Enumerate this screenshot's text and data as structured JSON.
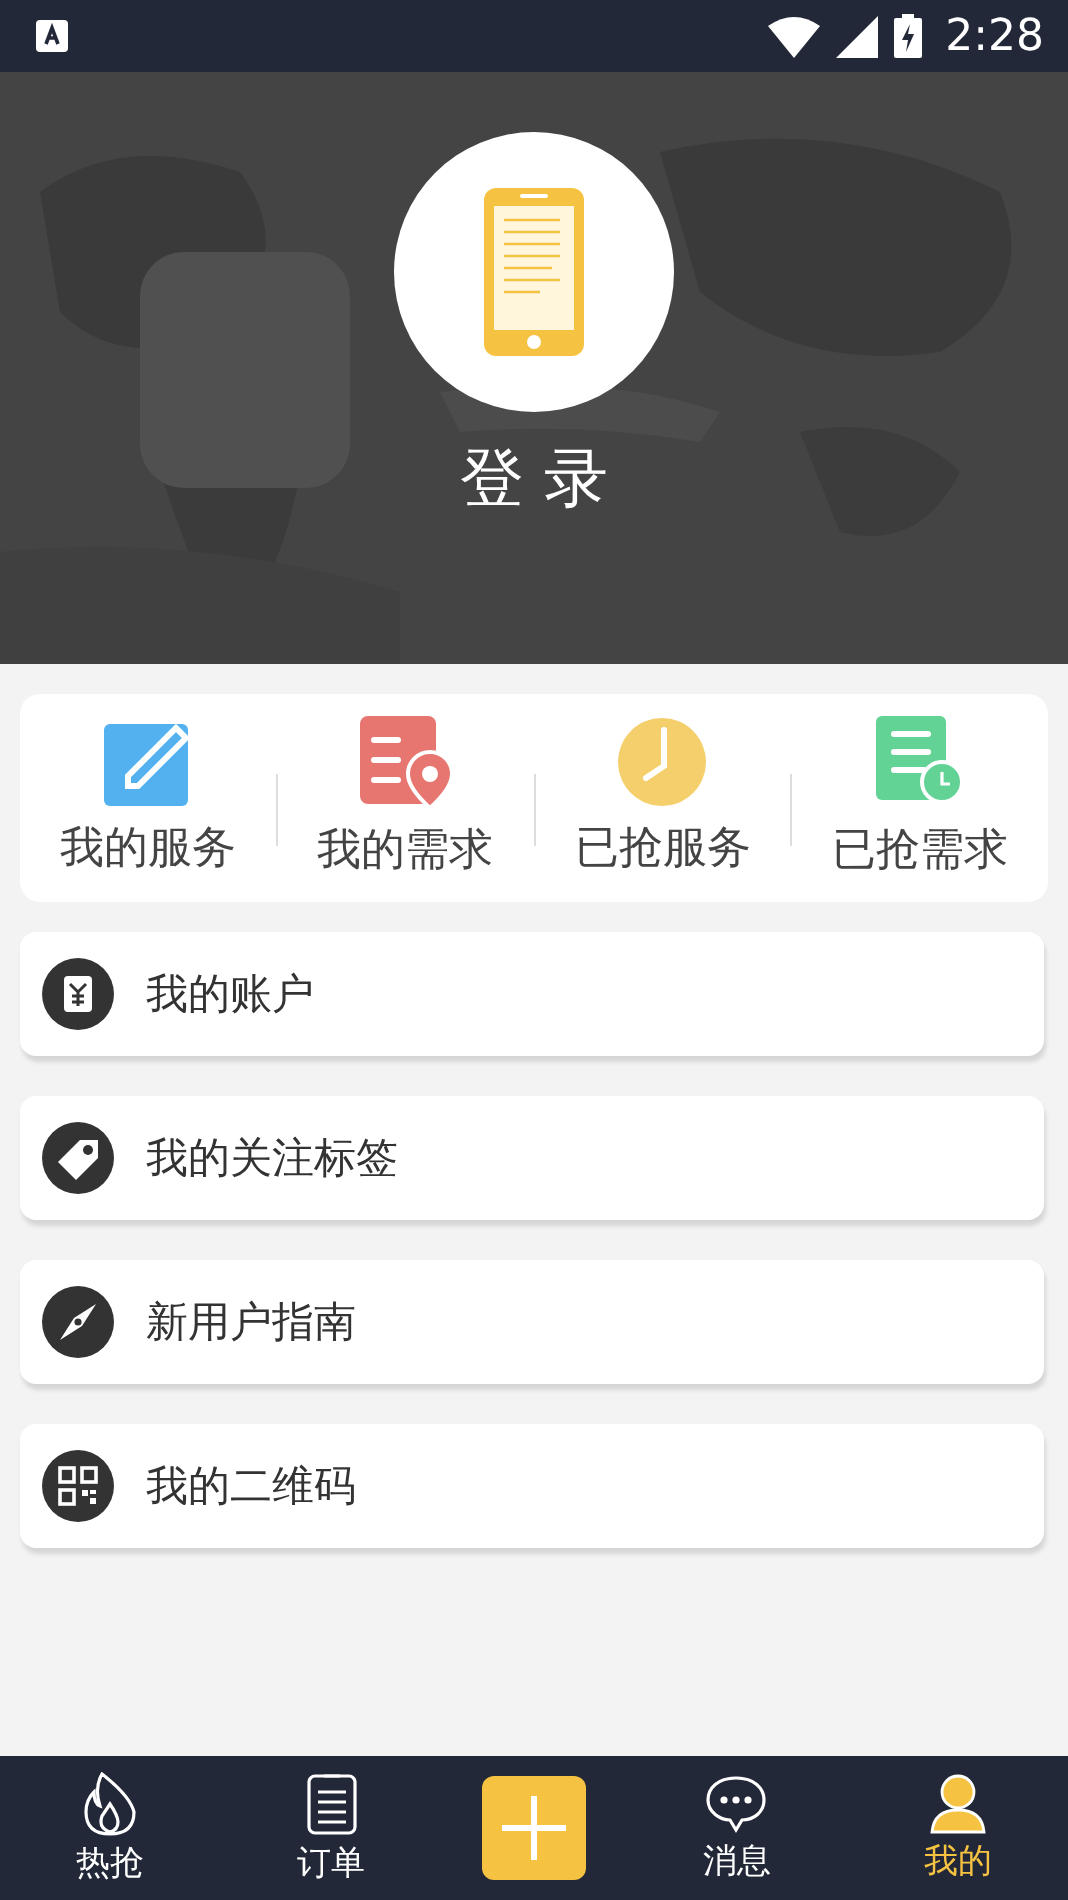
{
  "status_bar": {
    "time": "2:28"
  },
  "profile": {
    "login_label": "登 录"
  },
  "quick_actions": [
    {
      "kind": "edit",
      "label": "我的服务"
    },
    {
      "kind": "demand",
      "label": "我的需求"
    },
    {
      "kind": "clock",
      "label": "已抢服务"
    },
    {
      "kind": "alarm",
      "label": "已抢需求"
    }
  ],
  "menu": [
    {
      "kind": "account",
      "label": "我的账户"
    },
    {
      "kind": "tag",
      "label": "我的关注标签"
    },
    {
      "kind": "compass",
      "label": "新用户指南"
    },
    {
      "kind": "qr",
      "label": "我的二维码"
    }
  ],
  "bottom_nav": [
    {
      "kind": "flame",
      "label": "热抢",
      "selected": false
    },
    {
      "kind": "order",
      "label": "订单",
      "selected": false
    },
    {
      "kind": "add",
      "selected": false
    },
    {
      "kind": "chat",
      "label": "消息",
      "selected": false
    },
    {
      "kind": "user",
      "label": "我的",
      "selected": true
    }
  ]
}
